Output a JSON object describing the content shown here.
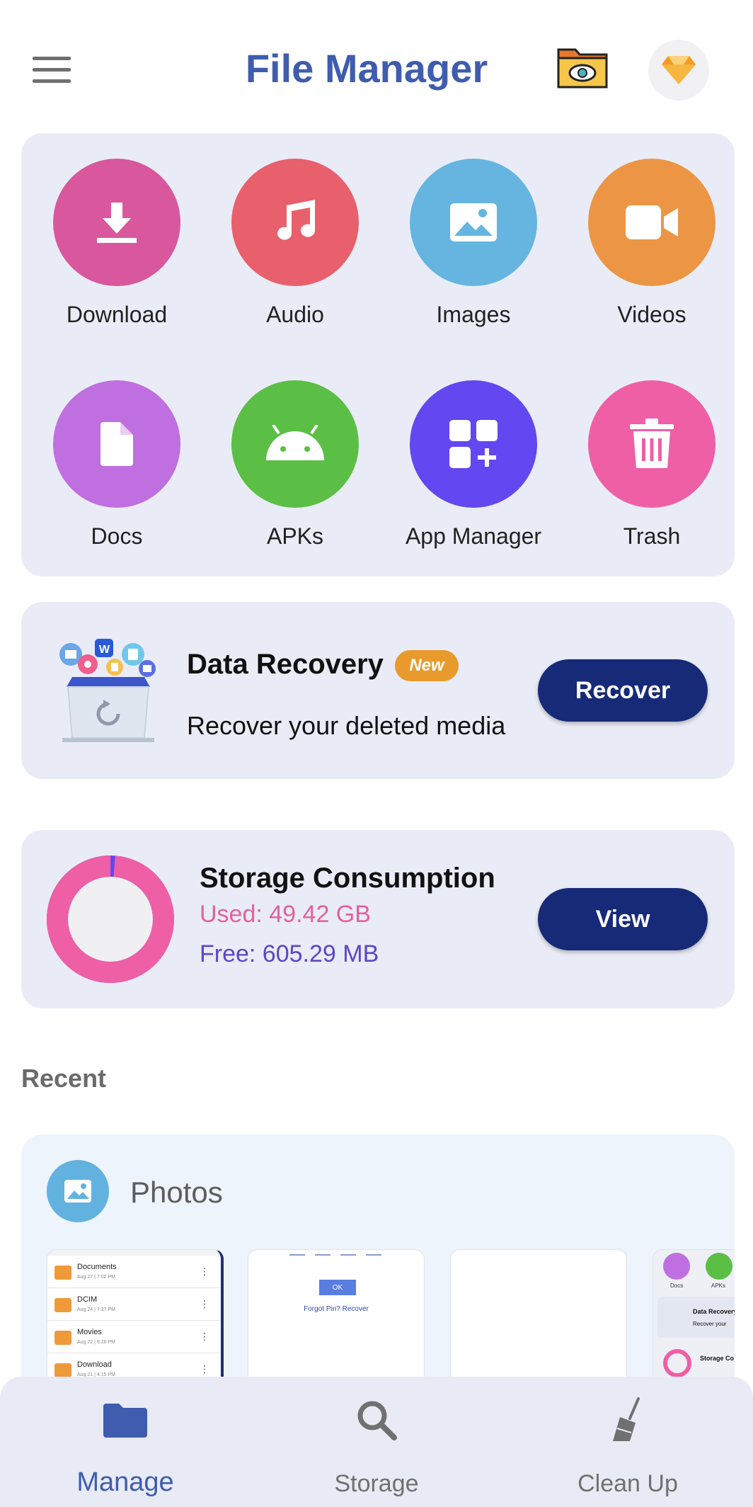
{
  "header": {
    "title": "File Manager",
    "menu_icon": "hamburger-menu-icon",
    "hidden_folder_icon": "folder-eye-icon",
    "premium_icon": "diamond-icon"
  },
  "categories": [
    {
      "label": "Download",
      "icon": "download-icon",
      "color": "#d9579d"
    },
    {
      "label": "Audio",
      "icon": "music-note-icon",
      "color": "#e8606c"
    },
    {
      "label": "Images",
      "icon": "image-icon",
      "color": "#65b5e0"
    },
    {
      "label": "Videos",
      "icon": "video-camera-icon",
      "color": "#ec9645"
    },
    {
      "label": "Docs",
      "icon": "document-icon",
      "color": "#c06fe0"
    },
    {
      "label": "APKs",
      "icon": "android-icon",
      "color": "#5cbf45"
    },
    {
      "label": "App Manager",
      "icon": "apps-add-icon",
      "color": "#6347f0"
    },
    {
      "label": "Trash",
      "icon": "trash-icon",
      "color": "#ef5fa6"
    }
  ],
  "recovery": {
    "title": "Data Recovery",
    "badge": "New",
    "subtitle": "Recover your deleted media",
    "button": "Recover"
  },
  "storage": {
    "title": "Storage Consumption",
    "used": "Used: 49.42 GB",
    "free": "Free: 605.29 MB",
    "button": "View",
    "used_fraction": 0.988,
    "used_color": "#ef5fa6",
    "free_color": "#6347f0"
  },
  "recent": {
    "title": "Recent",
    "group_label": "Photos",
    "thumb1_rows": [
      {
        "name": "Documents",
        "date": "Aug 27 | 7:02 PM"
      },
      {
        "name": "DCIM",
        "date": "Aug 24 | 7:37 PM"
      },
      {
        "name": "Movies",
        "date": "Aug 22 | 9:26 PM"
      },
      {
        "name": "Download",
        "date": "Aug 21 | 4:15 PM"
      }
    ],
    "thumb2": {
      "ok": "OK",
      "forgot": "Forgot Pin? Recover"
    },
    "thumb4": {
      "docs": "Docs",
      "apks": "APKs",
      "recovery": "Data Recovery",
      "recovery_sub": "Recover your",
      "storage": "Storage Co"
    }
  },
  "bottom_nav": [
    {
      "label": "Manage",
      "icon": "folder-icon",
      "active": true
    },
    {
      "label": "Storage",
      "icon": "search-icon",
      "active": false
    },
    {
      "label": "Clean Up",
      "icon": "broom-icon",
      "active": false
    }
  ],
  "colors": {
    "accent": "#3f5cae",
    "button": "#172a78",
    "card": "#e9ecf6"
  }
}
